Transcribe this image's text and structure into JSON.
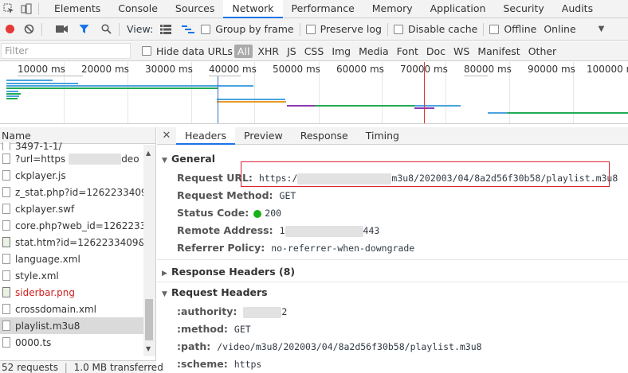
{
  "topbar": {
    "tabs": [
      "Elements",
      "Console",
      "Sources",
      "Network",
      "Performance",
      "Memory",
      "Application",
      "Security",
      "Audits"
    ],
    "active_tab": "Network"
  },
  "toolbar": {
    "view_label": "View:",
    "group_by_frame": "Group by frame",
    "preserve_log": "Preserve log",
    "disable_cache": "Disable cache",
    "offline": "Offline",
    "throttle_value": "Online"
  },
  "filterbar": {
    "placeholder": "Filter",
    "hide_data_urls": "Hide data URLs",
    "types": [
      "All",
      "XHR",
      "JS",
      "CSS",
      "Img",
      "Media",
      "Font",
      "Doc",
      "WS",
      "Manifest",
      "Other"
    ]
  },
  "overview": {
    "ticks": [
      "10000 ms",
      "20000 ms",
      "30000 ms",
      "40000 ms",
      "50000 ms",
      "60000 ms",
      "70000 ms",
      "80000 ms",
      "90000 ms",
      "100000 ms"
    ]
  },
  "list": {
    "header": "Name",
    "rows": [
      {
        "name": "3497-1-1/",
        "kind": "doc"
      },
      {
        "name": "?url=https",
        "kind": "doc",
        "suffix": "deo"
      },
      {
        "name": "ckplayer.js",
        "kind": "doc"
      },
      {
        "name": "z_stat.php?id=1262233409&w",
        "kind": "doc"
      },
      {
        "name": "ckplayer.swf",
        "kind": "doc"
      },
      {
        "name": "core.php?web_id=1262233409",
        "kind": "doc"
      },
      {
        "name": "stat.htm?id=1262233409&r=h",
        "kind": "img"
      },
      {
        "name": "language.xml",
        "kind": "doc"
      },
      {
        "name": "style.xml",
        "kind": "doc"
      },
      {
        "name": "siderbar.png",
        "kind": "error"
      },
      {
        "name": "crossdomain.xml",
        "kind": "doc"
      },
      {
        "name": "playlist.m3u8",
        "kind": "selected"
      },
      {
        "name": "0000.ts",
        "kind": "doc"
      }
    ],
    "requests": "52 requests",
    "transferred": "1.0 MB transferred"
  },
  "detail": {
    "tabs": [
      "Headers",
      "Preview",
      "Response",
      "Timing"
    ],
    "active_tab": "Headers",
    "general_title": "General",
    "request_url_key": "Request URL:",
    "request_url_prefix": "https:/",
    "request_url_suffix": "m3u8/202003/04/8a2d56f30b58/playlist.m3u8",
    "request_method_key": "Request Method:",
    "request_method": "GET",
    "status_code_key": "Status Code:",
    "status_code": "200",
    "remote_address_key": "Remote Address:",
    "remote_address_prefix": "1",
    "remote_address_port": "443",
    "referrer_policy_key": "Referrer Policy:",
    "referrer_policy": "no-referrer-when-downgrade",
    "response_headers_title": "Response Headers (8)",
    "request_headers_title": "Request Headers",
    "authority_key": ":authority:",
    "authority_suffix": "2",
    "method_key": ":method:",
    "method": "GET",
    "path_key": ":path:",
    "path": "/video/m3u8/202003/04/8a2d56f30b58/playlist.m3u8",
    "scheme_key": ":scheme:",
    "scheme": "https"
  },
  "colors": {
    "accent": "#1a73e8",
    "record": "#e53935",
    "status_ok": "#19b119",
    "error_text": "#d02020",
    "highlight_box": "#dd2233"
  }
}
